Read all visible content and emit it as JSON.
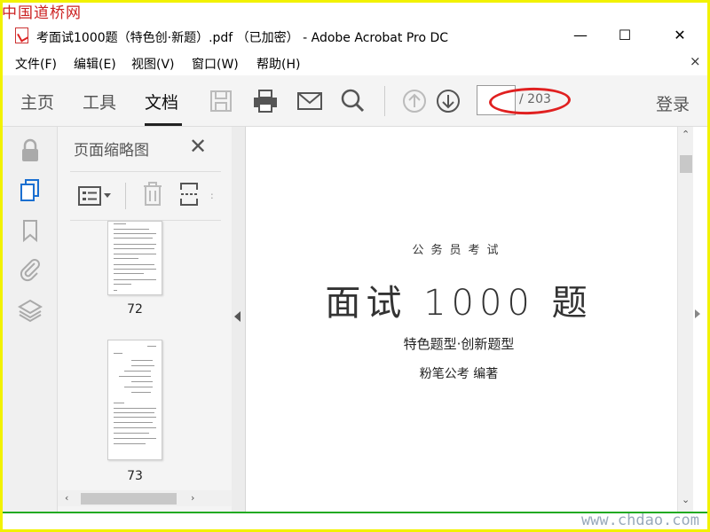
{
  "watermark": {
    "top": "中国道桥网",
    "bottom": "www.chdao.com"
  },
  "window": {
    "title": "考面试1000题（特色创·新题）.pdf （已加密） - Adobe Acrobat Pro DC",
    "minimize": "—",
    "maximize": "☐",
    "close": "✕"
  },
  "menu": {
    "items": [
      "文件(F)",
      "编辑(E)",
      "视图(V)",
      "窗口(W)",
      "帮助(H)"
    ],
    "close": "×"
  },
  "toolbar": {
    "tabs": [
      "主页",
      "工具",
      "文档"
    ],
    "active_tab": "文档",
    "icons": [
      "save-icon",
      "print-icon",
      "email-icon",
      "search-icon",
      "page-up-icon",
      "page-down-icon"
    ],
    "page_input": "",
    "page_total": "/ 203",
    "login": "登录"
  },
  "rail": {
    "icons": [
      "lock-icon",
      "pages-icon",
      "bookmark-icon",
      "attachment-icon",
      "layers-icon"
    ]
  },
  "thumbnails": {
    "title": "页面缩略图",
    "close": "✕",
    "pages": [
      {
        "label": "72"
      },
      {
        "label": "73"
      }
    ]
  },
  "document": {
    "subtitle": "公务员考试",
    "title": "面试 1000 题",
    "tagline": "特色题型·创新题型",
    "author": "粉笔公考    编著"
  },
  "colors": {
    "frame": "#f2f200",
    "annotation": "#e02020",
    "watermark_red": "#cc2222"
  }
}
